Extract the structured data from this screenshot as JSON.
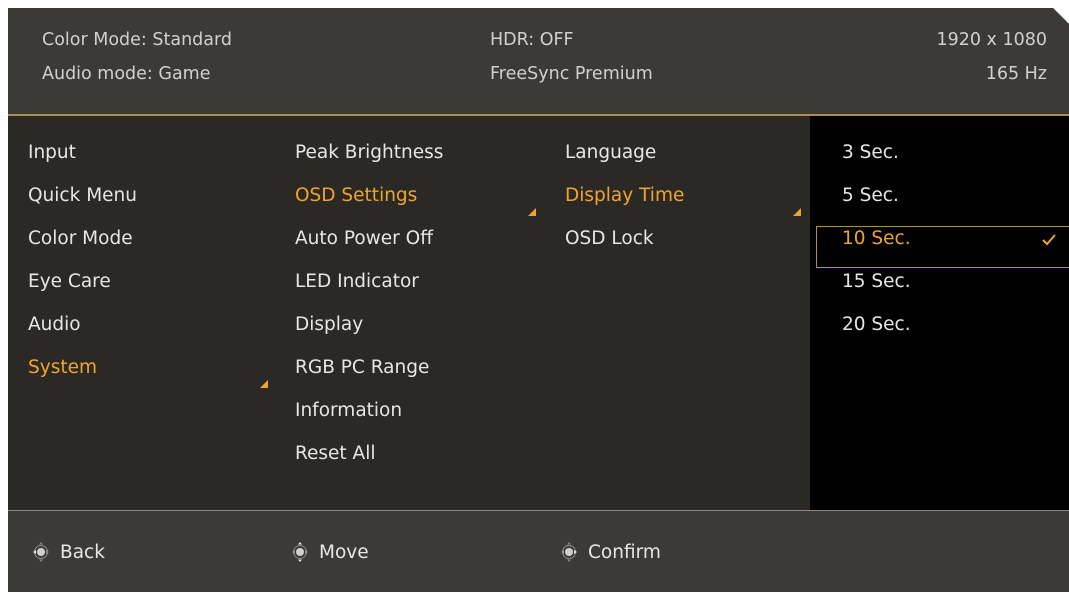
{
  "header": {
    "color_mode": "Color Mode: Standard",
    "audio_mode": "Audio mode: Game",
    "hdr": "HDR: OFF",
    "freesync": "FreeSync Premium",
    "resolution": "1920 x 1080",
    "refresh": "165 Hz"
  },
  "menu": {
    "main": [
      "Input",
      "Quick Menu",
      "Color Mode",
      "Eye Care",
      "Audio",
      "System"
    ],
    "main_active": 5,
    "system": [
      "Peak Brightness",
      "OSD Settings",
      "Auto Power Off",
      "LED Indicator",
      "Display",
      "RGB PC Range",
      "Information",
      "Reset All"
    ],
    "system_active": 1,
    "osd": [
      "Language",
      "Display Time",
      "OSD Lock"
    ],
    "osd_active": 1,
    "display_time": [
      "3 Sec.",
      "5 Sec.",
      "10 Sec.",
      "15 Sec.",
      "20 Sec."
    ],
    "display_time_selected": 2
  },
  "footer": {
    "back": "Back",
    "move": "Move",
    "confirm": "Confirm"
  },
  "colors": {
    "accent": "#f0a52a",
    "panel": "#2b2926",
    "header": "#3c3a37",
    "options_bg": "#000000"
  },
  "icons": [
    "joystick-icon",
    "checkmark-icon",
    "submenu-arrow-icon"
  ]
}
